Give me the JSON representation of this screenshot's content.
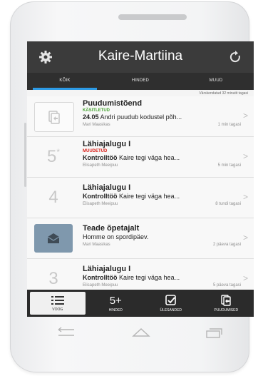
{
  "header": {
    "title": "Kaire-Martiina"
  },
  "tabs": [
    {
      "label": "KÕIK",
      "active": true
    },
    {
      "label": "HINDED",
      "active": false
    },
    {
      "label": "MUUD",
      "active": false
    }
  ],
  "updated_text": "Värskendatud 32 minutit tagasi",
  "items": [
    {
      "title": "Puudumistõend",
      "status": "KÄSITLETUD",
      "status_color": "#47a432",
      "bold": "24.05",
      "text": "Andri puudub kodustel põh...",
      "author": "Mari Maasikas",
      "time": "1 min tagasi",
      "badge": "document-icon"
    },
    {
      "title": "Lähiajalugu I",
      "status": "MUUDETUD",
      "status_color": "#d9221c",
      "bold": "Kontrolltöö",
      "text": "Kaire tegi väga hea...",
      "author": "Elisapeth Meeipuu",
      "time": "5 min tagasi",
      "grade": "5",
      "grade_sup": "*"
    },
    {
      "title": "Lähiajalugu I",
      "bold": "Kontrolltöö",
      "text": "Kaire tegi väga hea...",
      "author": "Elisapeth Meeipuu",
      "time": "8 tundi tagasi",
      "grade": "4"
    },
    {
      "title": "Teade õpetajalt",
      "text": "Homme on spordipäev.",
      "author": "Mari Maasikas",
      "time": "2 päeva tagasi",
      "badge": "envelope-icon"
    },
    {
      "title": "Lähiajalugu I",
      "bold": "Kontrolltöö",
      "text": "Kaire tegi väga hea...",
      "author": "Elisapeth Meeipuu",
      "time": "5 päeva tagasi",
      "grade": "3"
    }
  ],
  "bottom_nav": [
    {
      "label": "VOOG",
      "icon": "list-icon",
      "active": true
    },
    {
      "label": "HINDED",
      "icon": "grade-icon",
      "active": false
    },
    {
      "label": "ÜLESANDED",
      "icon": "tasks-icon",
      "active": false
    },
    {
      "label": "PUUDUMISED",
      "icon": "absences-icon",
      "active": false
    }
  ],
  "grade_icon_text": "5+",
  "chevron": ">",
  "colors": {
    "header": "#3b3b3b",
    "accent": "#2d9be6",
    "nav": "#2b2b2b"
  }
}
